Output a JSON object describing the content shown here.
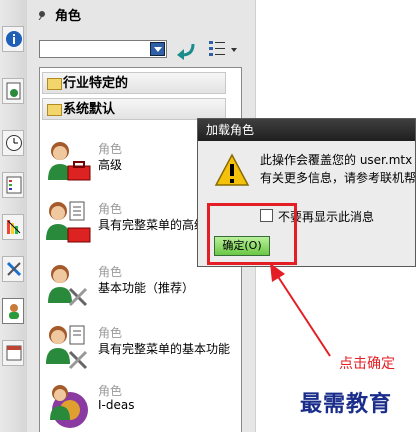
{
  "panel": {
    "title": "角色",
    "combo_value": ""
  },
  "groups": [
    "行业特定的",
    "系统默认"
  ],
  "roles": [
    {
      "category": "角色",
      "name": "高级"
    },
    {
      "category": "角色",
      "name": "具有完整菜单的高级"
    },
    {
      "category": "角色",
      "name": "基本功能（推荐）"
    },
    {
      "category": "角色",
      "name": "具有完整菜单的基本功能"
    },
    {
      "category": "角色",
      "name": "I-deas"
    }
  ],
  "dialog": {
    "title": "加载角色",
    "line1": "此操作会覆盖您的 user.mtx 文",
    "line2": "有关更多信息，请参考联机帮",
    "checkbox_label": "不要再显示此消息",
    "ok_label": "确定(O)"
  },
  "annotation": {
    "callout": "点击确定",
    "watermark": "最需教育",
    "color": "#e31e24"
  }
}
